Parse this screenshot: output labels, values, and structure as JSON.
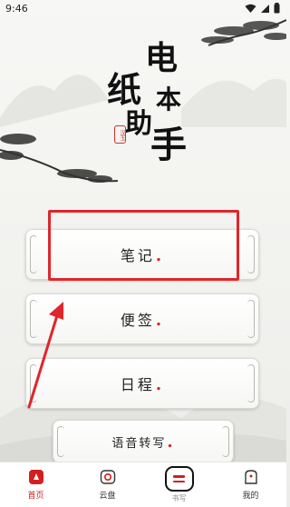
{
  "status_bar": {
    "time": "9:46"
  },
  "title": {
    "chars": [
      "电",
      "纸",
      "本",
      "助",
      "手"
    ],
    "seal": "汉玉"
  },
  "menu": [
    {
      "label": "笔记",
      "dot": "."
    },
    {
      "label": "便签",
      "dot": "."
    },
    {
      "label": "日程",
      "dot": "."
    },
    {
      "label": "语音转写",
      "dot": "."
    }
  ],
  "bottom_nav": {
    "home": "首页",
    "cloud": "云盘",
    "center": "书写",
    "mine": "我的"
  },
  "colors": {
    "accent": "#d21f1f",
    "highlight": "#e0262b"
  }
}
